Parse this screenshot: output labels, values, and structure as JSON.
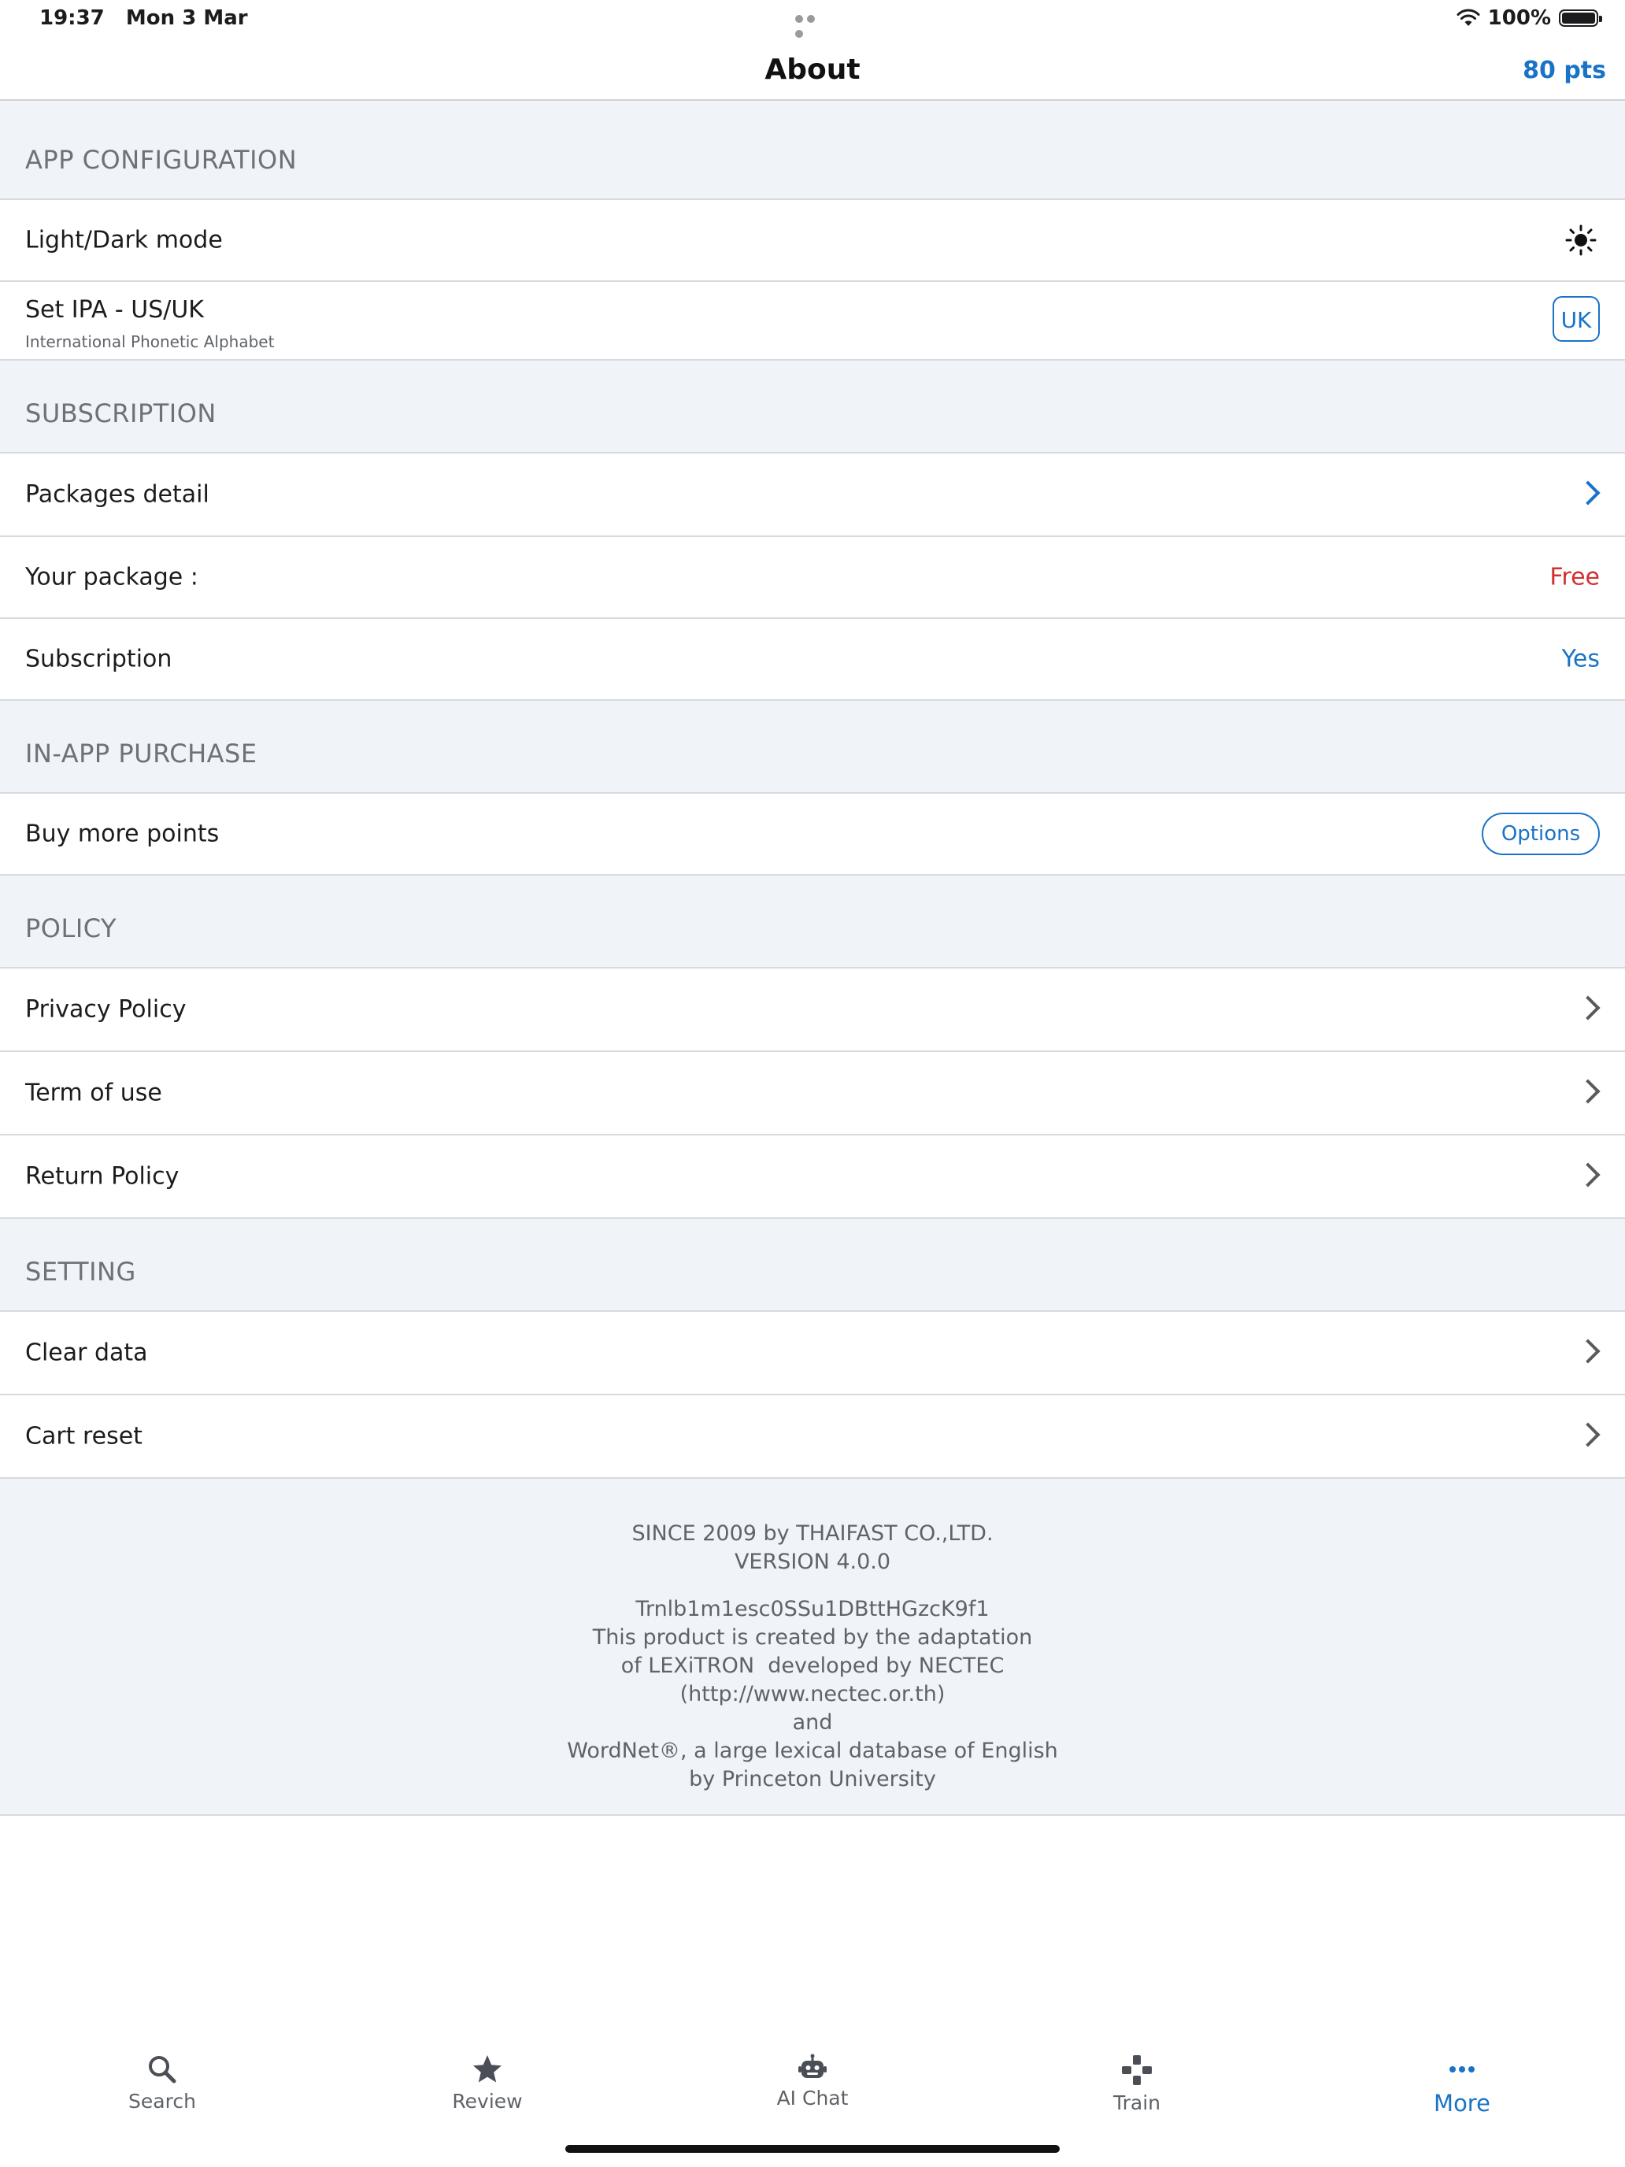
{
  "status_bar": {
    "time": "19:37",
    "date": "Mon 3 Mar",
    "battery": "100%"
  },
  "nav": {
    "title": "About",
    "points": "80 pts"
  },
  "sections": {
    "app_config": {
      "header": "APP CONFIGURATION",
      "light_dark": "Light/Dark mode",
      "ipa_label": "Set IPA - US/UK",
      "ipa_sub": "International Phonetic Alphabet",
      "ipa_value": "UK"
    },
    "subscription": {
      "header": "SUBSCRIPTION",
      "packages": "Packages detail",
      "your_package": "Your package :",
      "your_package_value": "Free",
      "subscription": "Subscription",
      "subscription_value": "Yes"
    },
    "iap": {
      "header": "IN-APP PURCHASE",
      "buy_points": "Buy more points",
      "options": "Options"
    },
    "policy": {
      "header": "POLICY",
      "privacy": "Privacy Policy",
      "terms": "Term of use",
      "return": "Return Policy"
    },
    "setting": {
      "header": "SETTING",
      "clear": "Clear data",
      "cart": "Cart reset"
    }
  },
  "footer": {
    "since": "SINCE 2009 by THAIFAST CO.,LTD.",
    "version": "VERSION 4.0.0",
    "id": "Trnlb1m1esc0SSu1DBttHGzcK9f1",
    "line1": "This product is created by the adaptation",
    "line2": "of LEXiTRON  developed by NECTEC",
    "line3": "(http://www.nectec.or.th)",
    "line4": "and",
    "line5": "WordNet®, a large lexical database of English",
    "line6": "by Princeton University"
  },
  "tabs": [
    {
      "label": "Search",
      "icon": "search-icon"
    },
    {
      "label": "Review",
      "icon": "star-icon"
    },
    {
      "label": "AI Chat",
      "icon": "robot-icon"
    },
    {
      "label": "Train",
      "icon": "gamepad-icon"
    },
    {
      "label": "More",
      "icon": "more-icon"
    }
  ],
  "colors": {
    "accent": "#1a73c7",
    "free": "#d32f2f",
    "section_bg": "#f0f3f7"
  }
}
